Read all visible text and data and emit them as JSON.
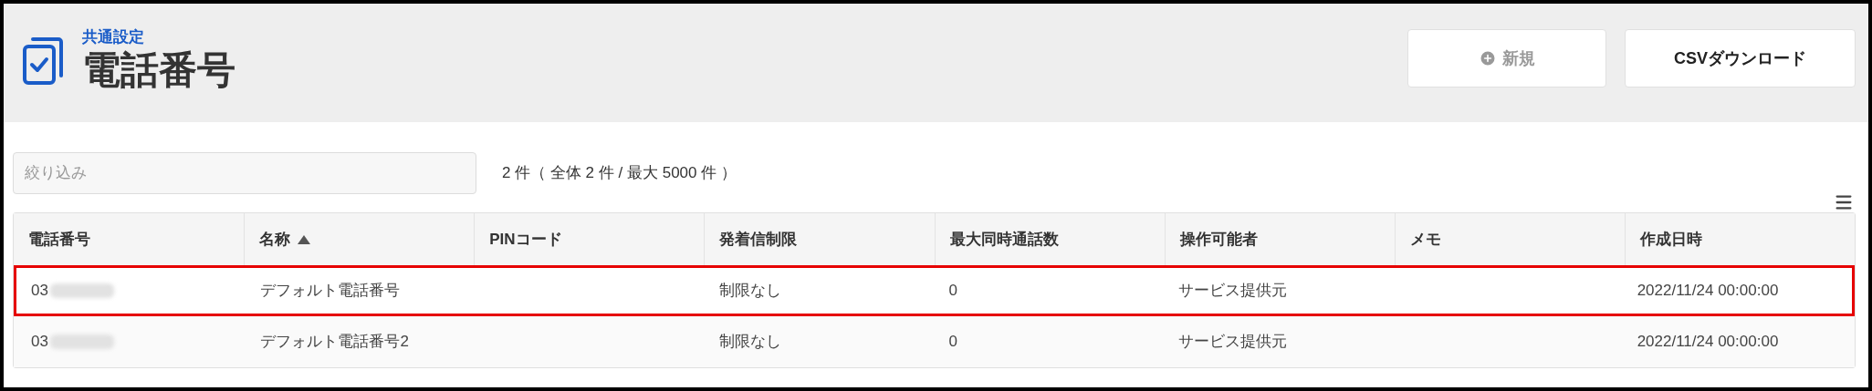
{
  "header": {
    "category": "共通設定",
    "title": "電話番号",
    "buttons": [
      {
        "kind": "new",
        "label": "新規",
        "disabled": true
      },
      {
        "kind": "plain",
        "label": "CSVダウンロード",
        "disabled": false
      }
    ]
  },
  "filter": {
    "placeholder": "絞り込み"
  },
  "count": "2 件（ 全体 2 件 / 最大 5000 件 ）",
  "table": {
    "columns": [
      {
        "label": "電話番号",
        "sorted": false
      },
      {
        "label": "名称",
        "sorted": true
      },
      {
        "label": "PINコード",
        "sorted": false
      },
      {
        "label": "発着信制限",
        "sorted": false
      },
      {
        "label": "最大同時通話数",
        "sorted": false
      },
      {
        "label": "操作可能者",
        "sorted": false
      },
      {
        "label": "メモ",
        "sorted": false
      },
      {
        "label": "作成日時",
        "sorted": false
      }
    ],
    "rows": [
      {
        "highlighted": true,
        "cells": [
          "03",
          "デフォルト電話番号",
          "",
          "制限なし",
          "0",
          "サービス提供元",
          "",
          "2022/11/24 00:00:00"
        ]
      },
      {
        "highlighted": false,
        "cells": [
          "03",
          "デフォルト電話番号2",
          "",
          "制限なし",
          "0",
          "サービス提供元",
          "",
          "2022/11/24 00:00:00"
        ]
      }
    ]
  }
}
